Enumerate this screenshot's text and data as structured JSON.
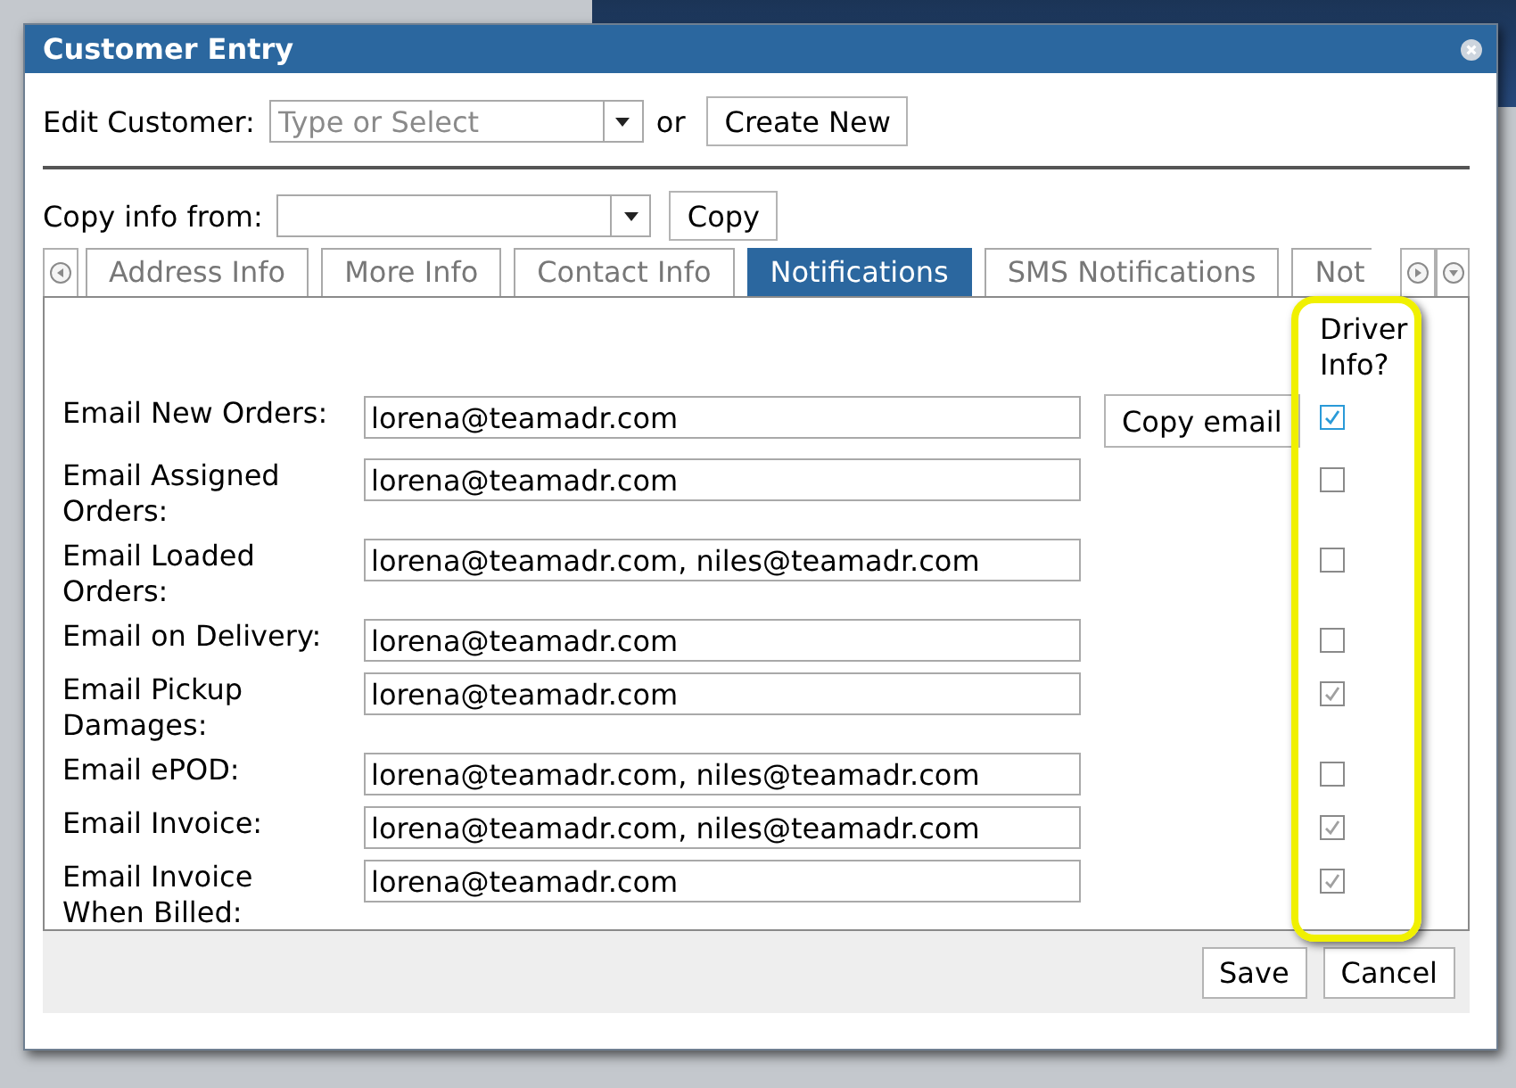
{
  "dialog": {
    "title": "Customer Entry"
  },
  "edit_customer": {
    "label": "Edit Customer:",
    "placeholder": "Type or Select",
    "separator": "or",
    "button": "Create New"
  },
  "copy_info": {
    "label": "Copy info from:",
    "button": "Copy"
  },
  "tabs": [
    {
      "label": "Address Info",
      "selected": false
    },
    {
      "label": "More Info",
      "selected": false
    },
    {
      "label": "Contact Info",
      "selected": false
    },
    {
      "label": "Notifications",
      "selected": true
    },
    {
      "label": "SMS Notifications",
      "selected": false
    },
    {
      "label": "Not",
      "selected": false
    }
  ],
  "notifications": {
    "column_header": "Driver Info?",
    "rows": [
      {
        "label": "Email New Orders:",
        "value": "lorena@teamadr.com",
        "action": "Copy email",
        "driver_info": true,
        "focused": true
      },
      {
        "label": "Email Assigned Orders:",
        "value": "lorena@teamadr.com",
        "driver_info": false,
        "focused": false
      },
      {
        "label": "Email Loaded Orders:",
        "value": "lorena@teamadr.com, niles@teamadr.com",
        "driver_info": false,
        "focused": false
      },
      {
        "label": "Email on Delivery:",
        "value": "lorena@teamadr.com",
        "driver_info": false,
        "focused": false
      },
      {
        "label": "Email Pickup Damages:",
        "value": "lorena@teamadr.com",
        "driver_info": true,
        "focused": false
      },
      {
        "label": "Email ePOD:",
        "value": "lorena@teamadr.com, niles@teamadr.com",
        "driver_info": false,
        "focused": false
      },
      {
        "label": "Email Invoice:",
        "value": "lorena@teamadr.com, niles@teamadr.com",
        "driver_info": true,
        "focused": false
      },
      {
        "label": "Email Invoice When Billed:",
        "value": "lorena@teamadr.com",
        "driver_info": true,
        "focused": false
      }
    ]
  },
  "buttons": [
    "Save",
    "Cancel"
  ]
}
